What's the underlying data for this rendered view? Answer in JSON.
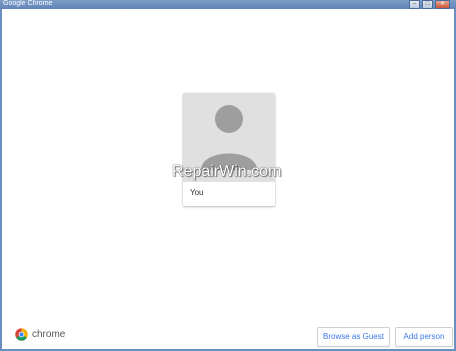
{
  "window": {
    "title": "Google Chrome",
    "controls": [
      "minimize",
      "maximize",
      "close"
    ]
  },
  "profiles": [
    {
      "name": "You",
      "icon": "person-silhouette-icon"
    }
  ],
  "watermark": "RepairWin.com",
  "footer": {
    "brand": "chrome",
    "buttons": {
      "guest": "Browse as Guest",
      "add": "Add person"
    }
  },
  "colors": {
    "accent": "#3b78e7",
    "avatar_bg": "#e0e0e0",
    "avatar_fg": "#9e9e9e",
    "titlebar": "#6b8fc0"
  }
}
